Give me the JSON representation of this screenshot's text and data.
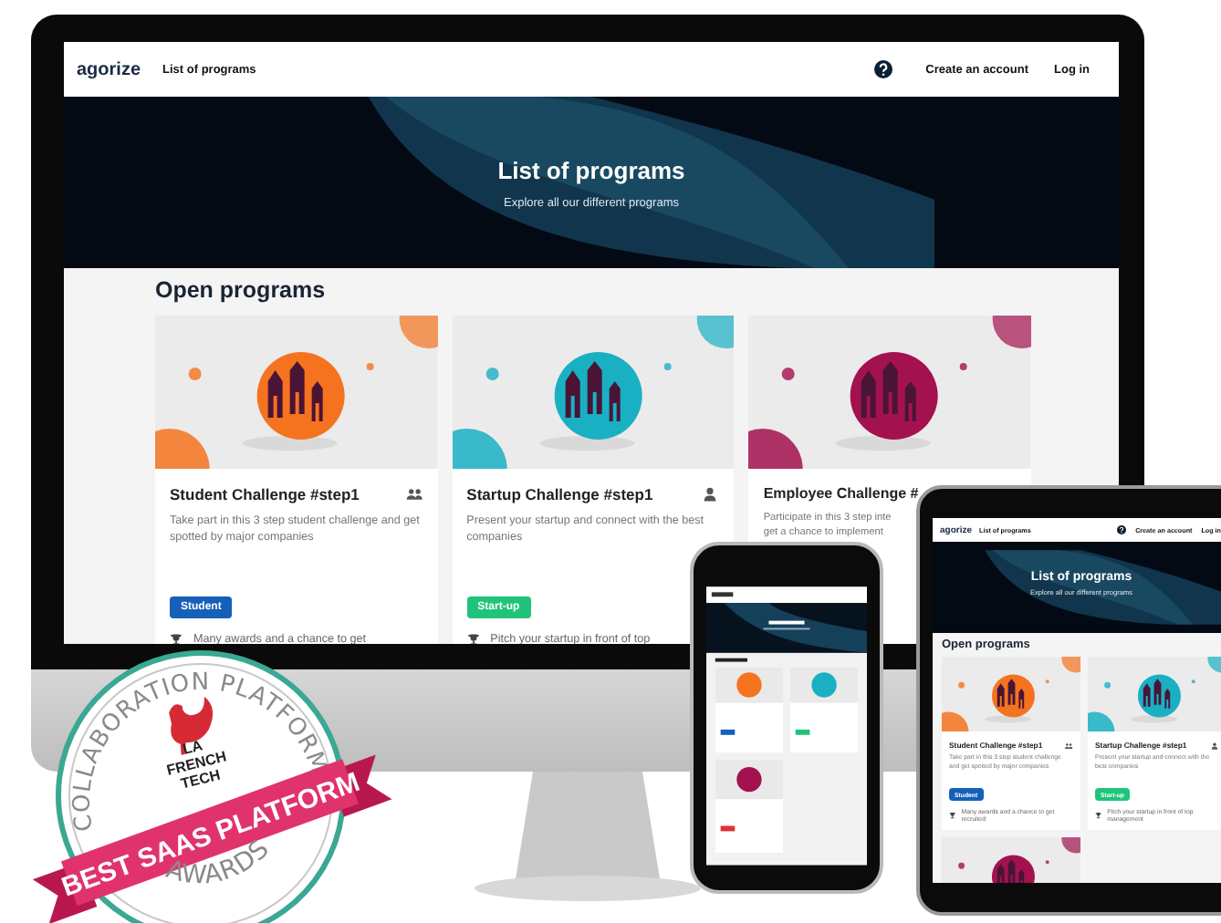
{
  "monitor": {
    "nav": {
      "logo": "agorize",
      "page_link": "List of programs",
      "create_account": "Create an account",
      "login": "Log in"
    },
    "hero": {
      "title": "List of programs",
      "subtitle": "Explore all our different programs"
    },
    "section_title": "Open programs",
    "cards": [
      {
        "kind": "team",
        "color": "#f5731f",
        "title": "Student Challenge #step1",
        "description": "Take part in this 3 step student challenge and get spotted by major companies",
        "tag": {
          "label": "Student",
          "color": "#1560b8"
        },
        "perks": [
          "Many awards and a chance to get"
        ]
      },
      {
        "kind": "solo",
        "color": "#1ab0c4",
        "title": "Startup Challenge #step1",
        "description": "Present your startup and connect with the best companies",
        "tag": {
          "label": "Start-up",
          "color": "#1fc47a"
        },
        "perks": [
          "Pitch your startup in front of top"
        ]
      },
      {
        "kind": "partial",
        "color": "#a3124f",
        "title": "Employee Challenge #",
        "description": "Participate in this 3 step inte\nget a chance to implement"
      }
    ]
  },
  "tablet": {
    "nav": {
      "logo": "agorize",
      "page_link": "List of programs",
      "create_account": "Create an account",
      "login": "Log in"
    },
    "hero": {
      "title": "List of programs",
      "subtitle": "Explore all our different programs"
    },
    "section_title": "Open programs",
    "cards": [
      {
        "kind": "team",
        "color": "#f5731f",
        "title": "Student Challenge #step1",
        "description": "Take part in this 3 step student challenge and get spotted by major companies",
        "tag": {
          "label": "Student",
          "color": "#1560b8"
        },
        "perks": [
          "Many awards and a chance to get recruited"
        ]
      },
      {
        "kind": "solo",
        "color": "#1ab0c4",
        "title": "Startup Challenge #step1",
        "description": "Present your startup and connect with the best companies",
        "tag": {
          "label": "Start-up",
          "color": "#1fc47a"
        },
        "perks": [
          "Pitch your startup in front of top management"
        ]
      },
      {
        "kind": "image",
        "color": "#a3124f"
      }
    ]
  },
  "badge": {
    "top_arc": "COLLABORATION PLATFORM",
    "logo_lines": [
      "LA",
      "FRENCH",
      "TECH"
    ],
    "ribbon": "BEST SAAS PLATFORM",
    "bottom_arc": "AWARDS"
  }
}
